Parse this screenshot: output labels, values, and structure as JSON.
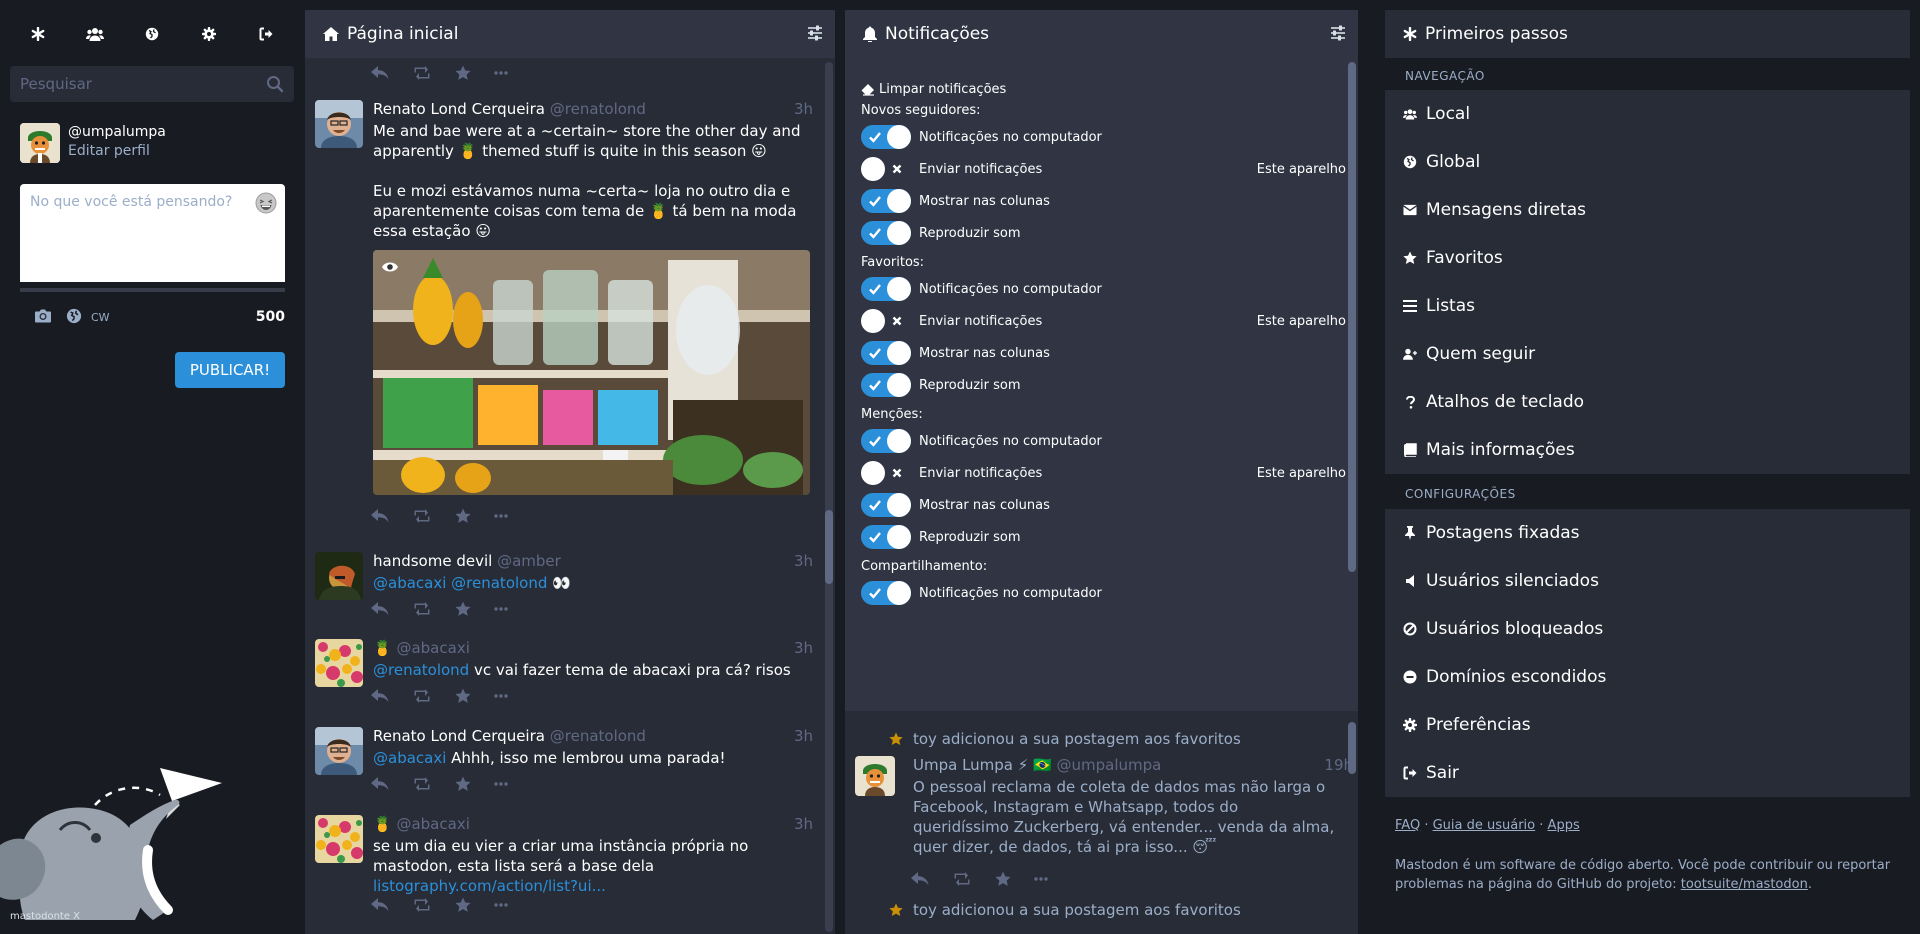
{
  "drawer": {
    "tab_icons": [
      "asterisk-icon",
      "users-icon",
      "globe-icon",
      "gear-icon",
      "sign-out-icon"
    ],
    "search_placeholder": "Pesquisar",
    "account_handle": "@umpalumpa",
    "edit_profile": "Editar perfil",
    "composer_placeholder": "No que você está pensando?",
    "cw_label": "CW",
    "char_count": "500",
    "publish_label": "PUBLICAR!",
    "brand_label": "mastodonte X"
  },
  "home": {
    "title": "Página inicial",
    "statuses": [
      {
        "name": "Renato Lond Cerqueira",
        "acct": "@renatolond",
        "time": "3h",
        "text_en_1": "Me and bae were at a ~certain~ store the other day and apparently",
        "text_en_2": "themed stuff is quite in this season",
        "text_pt_1": "Eu e mozi estávamos numa ~certa~ loja no outro dia e aparentemente coisas com tema de",
        "text_pt_2": "tá bem na moda essa estação"
      },
      {
        "name": "handsome devil",
        "acct": "@amber",
        "time": "3h",
        "mention_1": "@abacaxi",
        "mention_2": "@renatolond",
        "emoji": "👀"
      },
      {
        "name": "🍍",
        "acct": "@abacaxi",
        "time": "3h",
        "mention": "@renatolond",
        "text": " vc vai fazer tema de abacaxi pra cá? risos"
      },
      {
        "name": "Renato Lond Cerqueira",
        "acct": "@renatolond",
        "time": "3h",
        "mention": "@abacaxi",
        "text": " Ahhh, isso me lembrou uma parada!"
      },
      {
        "name": "🍍",
        "acct": "@abacaxi",
        "time": "3h",
        "text": "se um dia eu vier a criar uma instância própria no mastodon, esta lista será a base dela",
        "link": "listography.com/action/list?ui..."
      }
    ]
  },
  "notifications": {
    "title": "Notificações",
    "clear": "Limpar notificações",
    "sections": [
      {
        "title": "Novos seguidores:",
        "rows": [
          {
            "label": "Notificações no computador",
            "on": true
          },
          {
            "label": "Enviar notificações",
            "on": false,
            "device": "Este aparelho"
          },
          {
            "label": "Mostrar nas colunas",
            "on": true
          },
          {
            "label": "Reproduzir som",
            "on": true
          }
        ]
      },
      {
        "title": "Favoritos:",
        "rows": [
          {
            "label": "Notificações no computador",
            "on": true
          },
          {
            "label": "Enviar notificações",
            "on": false,
            "device": "Este aparelho"
          },
          {
            "label": "Mostrar nas colunas",
            "on": true
          },
          {
            "label": "Reproduzir som",
            "on": true
          }
        ]
      },
      {
        "title": "Menções:",
        "rows": [
          {
            "label": "Notificações no computador",
            "on": true
          },
          {
            "label": "Enviar notificações",
            "on": false,
            "device": "Este aparelho"
          },
          {
            "label": "Mostrar nas colunas",
            "on": true
          },
          {
            "label": "Reproduzir som",
            "on": true
          }
        ]
      },
      {
        "title": "Compartilhamento:",
        "rows": [
          {
            "label": "Notificações no computador",
            "on": true
          }
        ]
      }
    ],
    "items": [
      {
        "line": "toy adicionou a sua postagem aos favoritos",
        "name": "Umpa Lumpa ⚡ 🇧🇷",
        "acct": "@umpalumpa",
        "time": "19h",
        "text": "O pessoal reclama de coleta de dados mas não larga o Facebook, Instagram e Whatsapp, todos do queridíssimo Zuckerberg, vá entender... venda da alma, quer dizer, de dados, tá ai pra isso...",
        "emoji": "😴"
      },
      {
        "line": "toy adicionou a sua postagem aos favoritos"
      }
    ]
  },
  "getting_started": {
    "title": "Primeiros passos",
    "nav_heading": "NAVEGAÇÃO",
    "nav": [
      {
        "label": "Local",
        "icon": "users-icon"
      },
      {
        "label": "Global",
        "icon": "globe-icon"
      },
      {
        "label": "Mensagens diretas",
        "icon": "envelope-icon"
      },
      {
        "label": "Favoritos",
        "icon": "star-icon"
      },
      {
        "label": "Listas",
        "icon": "list-icon"
      },
      {
        "label": "Quem seguir",
        "icon": "user-plus-icon"
      },
      {
        "label": "Atalhos de teclado",
        "icon": "question-icon"
      },
      {
        "label": "Mais informações",
        "icon": "book-icon"
      }
    ],
    "settings_heading": "CONFIGURAÇÕES",
    "settings": [
      {
        "label": "Postagens fixadas",
        "icon": "pin-icon"
      },
      {
        "label": "Usuários silenciados",
        "icon": "volume-off-icon"
      },
      {
        "label": "Usuários bloqueados",
        "icon": "ban-icon"
      },
      {
        "label": "Domínios escondidos",
        "icon": "minus-circle-icon"
      },
      {
        "label": "Preferências",
        "icon": "gear-icon"
      },
      {
        "label": "Sair",
        "icon": "sign-out-icon"
      }
    ],
    "footer_links": [
      "FAQ",
      "Guia de usuário",
      "Apps"
    ],
    "footer_sep": " · ",
    "footer_text": "Mastodon é um software de código aberto. Você pode contribuir ou reportar problemas na página do GitHub do projeto: ",
    "footer_repo": "tootsuite/mastodon",
    "footer_end": "."
  },
  "colors": {
    "accent": "#2b90d9",
    "bg": "#191b22",
    "column": "#282c37",
    "header": "#313543",
    "muted": "#606984",
    "secondary": "#9baec8",
    "fav": "#ca8f04"
  }
}
